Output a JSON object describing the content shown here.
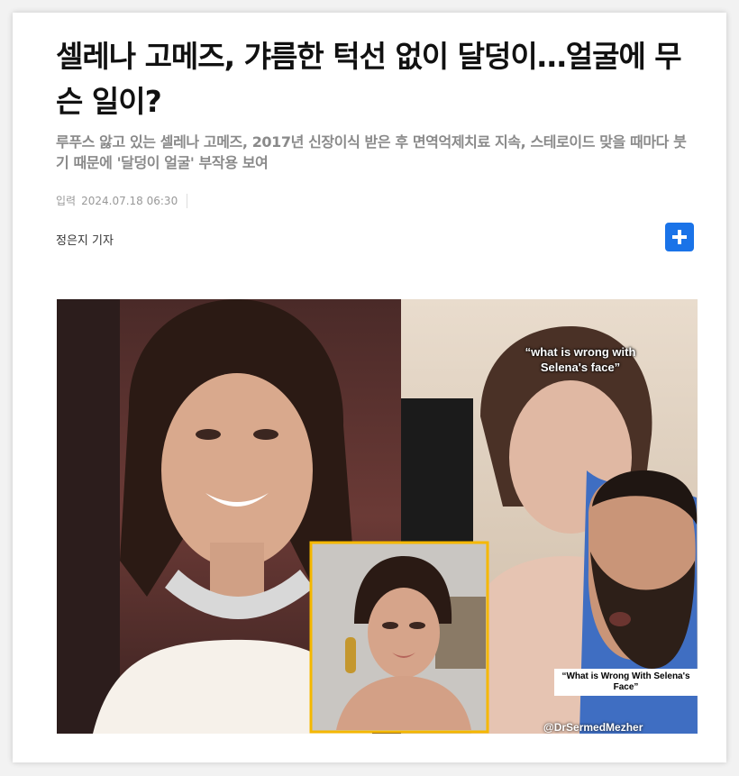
{
  "article": {
    "title": "셀레나 고메즈, 갸름한 턱선 없이 달덩이…얼굴에 무슨 일이?",
    "subtitle": "루푸스 앓고 있는 셀레나 고메즈, 2017년 신장이식 받은 후 면역억제치료 지속, 스테로이드 맞을 때마다 붓기 때문에 '달덩이 얼굴' 부작용 보여",
    "date_label": "입력",
    "date": "2024.07.18 06:30",
    "author": "정은지 기자"
  },
  "image": {
    "caption_top": "“what is wrong with Selena's face”",
    "caption_box": "“What is Wrong With Selena's Face”",
    "handle": "@DrSermedMezher"
  },
  "colors": {
    "accent": "#1a73e8",
    "inset_border": "#f5b800"
  },
  "icons": {
    "share": "plus-icon"
  }
}
